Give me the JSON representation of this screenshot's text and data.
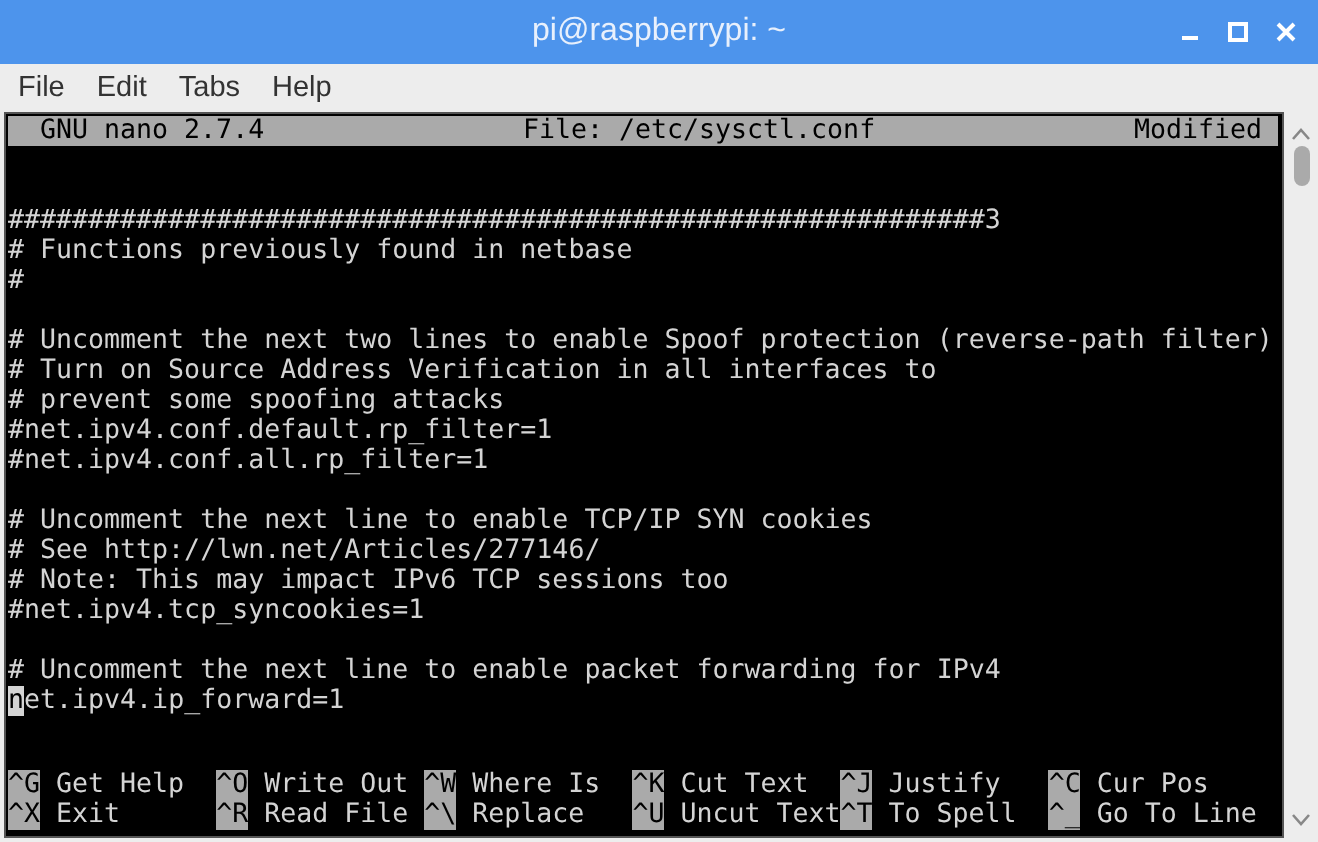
{
  "window": {
    "title": "pi@raspberrypi: ~"
  },
  "menu_bar": {
    "items": [
      "File",
      "Edit",
      "Tabs",
      "Help"
    ]
  },
  "nano": {
    "header": {
      "app": "GNU nano 2.7.4",
      "file": "File: /etc/sysctl.conf",
      "status": "Modified"
    },
    "lines": [
      {
        "kind": "blank"
      },
      {
        "kind": "blank"
      },
      {
        "kind": "text",
        "text": "#############################################################3",
        "cursor": false
      },
      {
        "kind": "text",
        "text": "# Functions previously found in netbase",
        "cursor": false
      },
      {
        "kind": "text",
        "text": "#",
        "cursor": false
      },
      {
        "kind": "blank"
      },
      {
        "kind": "text",
        "text": "# Uncomment the next two lines to enable Spoof protection (reverse-path filter)",
        "cursor": false
      },
      {
        "kind": "text",
        "text": "# Turn on Source Address Verification in all interfaces to",
        "cursor": false
      },
      {
        "kind": "text",
        "text": "# prevent some spoofing attacks",
        "cursor": false
      },
      {
        "kind": "text",
        "text": "#net.ipv4.conf.default.rp_filter=1",
        "cursor": false
      },
      {
        "kind": "text",
        "text": "#net.ipv4.conf.all.rp_filter=1",
        "cursor": false
      },
      {
        "kind": "blank"
      },
      {
        "kind": "text",
        "text": "# Uncomment the next line to enable TCP/IP SYN cookies",
        "cursor": false
      },
      {
        "kind": "text",
        "text": "# See http://lwn.net/Articles/277146/",
        "cursor": false
      },
      {
        "kind": "text",
        "text": "# Note: This may impact IPv6 TCP sessions too",
        "cursor": false
      },
      {
        "kind": "text",
        "text": "#net.ipv4.tcp_syncookies=1",
        "cursor": false
      },
      {
        "kind": "blank"
      },
      {
        "kind": "text",
        "text": "# Uncomment the next line to enable packet forwarding for IPv4",
        "cursor": false
      },
      {
        "kind": "text",
        "text": "net.ipv4.ip_forward=1",
        "cursor": true
      }
    ],
    "shortcuts": [
      {
        "key": "^G",
        "label": "Get Help"
      },
      {
        "key": "^O",
        "label": "Write Out"
      },
      {
        "key": "^W",
        "label": "Where Is"
      },
      {
        "key": "^K",
        "label": "Cut Text"
      },
      {
        "key": "^J",
        "label": "Justify"
      },
      {
        "key": "^C",
        "label": "Cur Pos"
      },
      {
        "key": "^X",
        "label": "Exit"
      },
      {
        "key": "^R",
        "label": "Read File"
      },
      {
        "key": "^\\",
        "label": "Replace"
      },
      {
        "key": "^U",
        "label": "Uncut Text"
      },
      {
        "key": "^T",
        "label": "To Spell"
      },
      {
        "key": "^_",
        "label": "Go To Line"
      }
    ]
  }
}
